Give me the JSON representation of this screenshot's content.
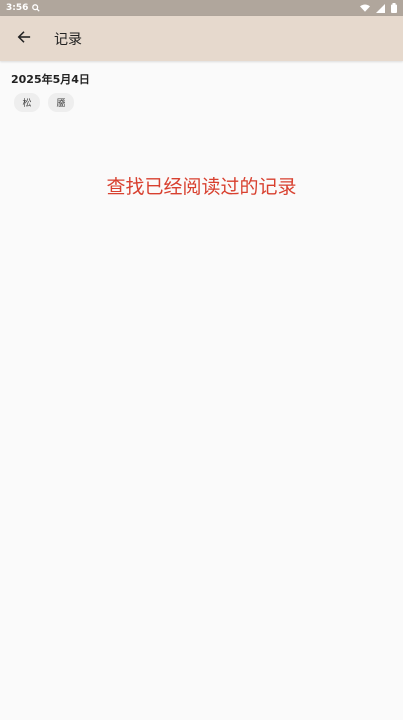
{
  "status_bar": {
    "time": "3:56",
    "icons": [
      "search-icon",
      "wifi-icon",
      "signal-icon",
      "battery-icon"
    ]
  },
  "app_bar": {
    "back_icon": "arrow-left-icon",
    "title": "记录"
  },
  "content": {
    "date": "2025年5月4日",
    "chips": [
      "松",
      "靥"
    ],
    "hint": "查找已经阅读过的记录"
  },
  "colors": {
    "status_bar_bg": "#b0a69c",
    "app_bar_bg": "#e6d9cd",
    "hint_text": "#d8402f",
    "chip_bg": "#eeeeee",
    "background": "#fafafa"
  }
}
